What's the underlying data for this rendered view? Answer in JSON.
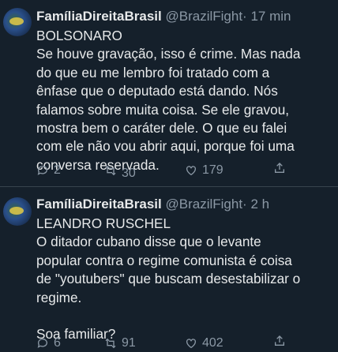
{
  "tweets": [
    {
      "name": "FamíliaDireitaBrasil",
      "handle": "@BrazilFight",
      "separator": "·",
      "time": "17 min",
      "lines": [
        "BOLSONARO",
        "Se houve gravação, isso é crime. Mas nada",
        "do que eu me lembro foi tratado com a",
        "ênfase que o deputado está dando. Nós",
        "falamos sobre muita coisa. Se ele gravou,",
        "mostra bem o caráter dele. O que eu falei",
        "com ele não vou abrir aqui, porque foi uma",
        "conversa reservada."
      ],
      "replies": "2",
      "retweets": "30",
      "likes": "179"
    },
    {
      "name": "FamíliaDireitaBrasil",
      "handle": "@BrazilFight",
      "separator": "·",
      "time": "2 h",
      "lines": [
        "LEANDRO RUSCHEL",
        "O ditador cubano disse que o levante",
        "popular contra o regime comunista é coisa",
        "de \"youtubers\" que buscam desestabilizar o",
        "regime.",
        "",
        "Soa familiar?"
      ],
      "replies": "6",
      "retweets": "91",
      "likes": "402"
    }
  ],
  "icons": {
    "reply": "reply-icon",
    "retweet": "retweet-icon",
    "like": "heart-icon",
    "share": "share-icon"
  },
  "colors": {
    "background": "#15202b",
    "text": "#e7e9ea",
    "secondary": "#8b98a5",
    "divider": "#38444d"
  }
}
